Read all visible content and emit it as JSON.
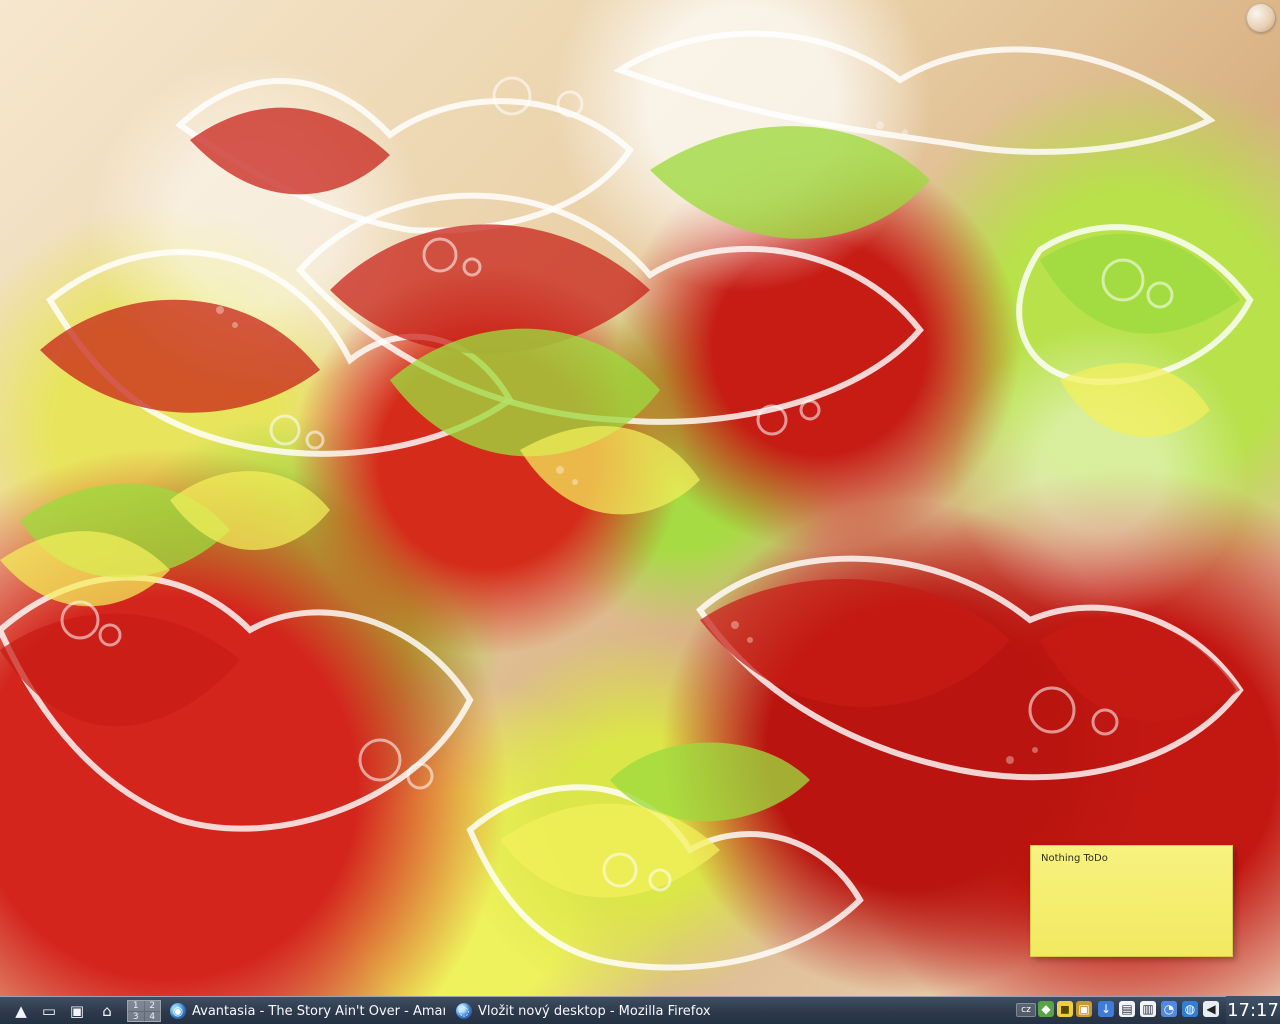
{
  "desktop": {
    "note_text": "Nothing ToDo"
  },
  "taskbar": {
    "pager": [
      "1",
      "2",
      "3",
      "4"
    ],
    "tasks": [
      {
        "label": "Avantasia - The Story Ain't Over - Amaro",
        "icon": "amarok-icon"
      },
      {
        "label": "Vložit nový desktop - Mozilla Firefox",
        "icon": "firefox-icon"
      }
    ],
    "language": "cz",
    "clock": "17:17"
  },
  "colors": {
    "taskbar_bg": "#2e3a4c",
    "taskbar_text": "#f7f8fb",
    "note_bg": "#f4ec6c",
    "wallpaper_red": "#c61c14",
    "wallpaper_green": "#a6db43",
    "wallpaper_yellow": "#eef25c"
  }
}
